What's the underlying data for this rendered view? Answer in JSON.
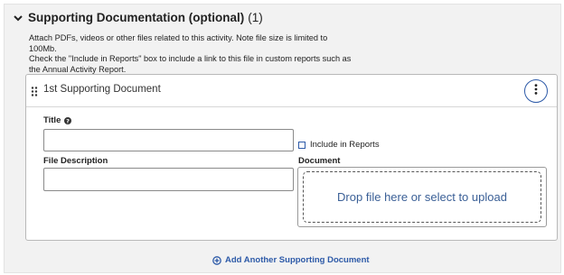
{
  "section": {
    "title": "Supporting Documentation (optional)",
    "count": "(1)",
    "help_line1": "Attach PDFs, videos or other files related to this activity. Note file size is limited to",
    "help_line2": "100Mb.",
    "help_line3": "Check the \"Include in Reports\" box to include a link to this file in custom reports such as",
    "help_line4": "the Annual Activity Report."
  },
  "document": {
    "heading": "1st Supporting Document",
    "title_label": "Title",
    "title_value": "",
    "include_label": "Include in Reports",
    "include_checked": false,
    "description_label": "File Description",
    "description_value": "",
    "document_label": "Document",
    "dropzone_text": "Drop file here or select to upload"
  },
  "actions": {
    "add_label": "Add Another Supporting Document"
  },
  "colors": {
    "accent": "#2d5aa8",
    "panel_bg": "#f2f2f2",
    "dropzone_text": "#3a5f96"
  },
  "icons": [
    "chevron-down-icon",
    "drag-handle-icon",
    "more-vertical-icon",
    "help-circle-icon",
    "plus-circle-icon"
  ]
}
